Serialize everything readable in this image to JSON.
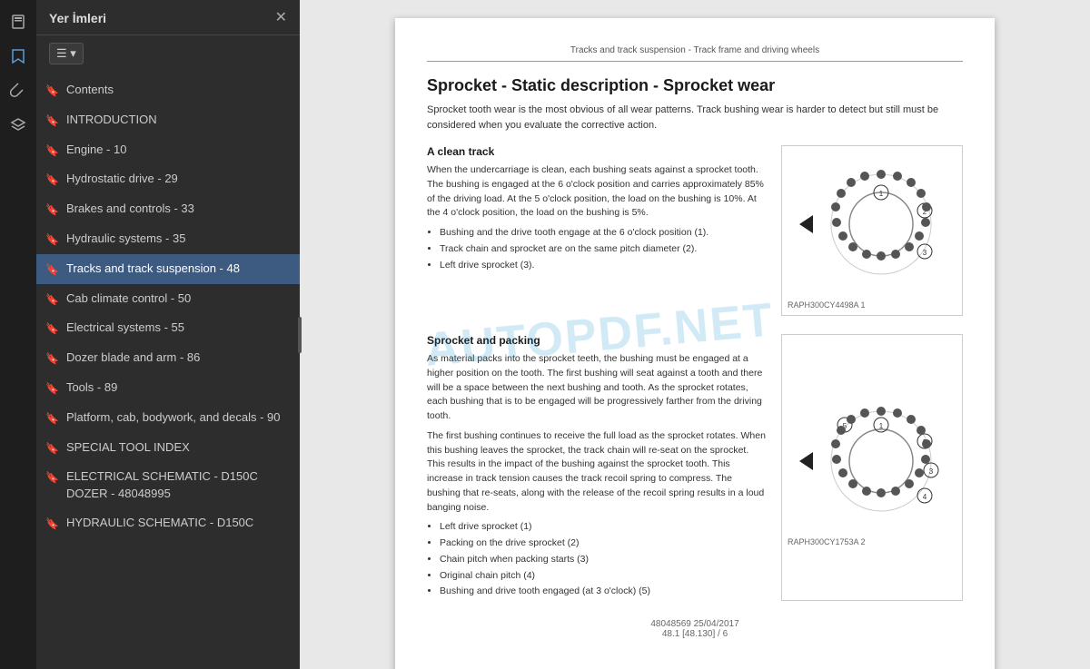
{
  "toolbar": {
    "icons": [
      "📋",
      "🔖",
      "📎",
      "⬡"
    ]
  },
  "sidebar": {
    "title": "Yer İmleri",
    "close_label": "✕",
    "list_button": "☰ ▾",
    "items": [
      {
        "label": "Contents",
        "active": false
      },
      {
        "label": "INTRODUCTION",
        "active": false
      },
      {
        "label": "Engine - 10",
        "active": false
      },
      {
        "label": "Hydrostatic drive - 29",
        "active": false
      },
      {
        "label": "Brakes and controls - 33",
        "active": false
      },
      {
        "label": "Hydraulic systems - 35",
        "active": false
      },
      {
        "label": "Tracks and track suspension - 48",
        "active": true
      },
      {
        "label": "Cab climate control - 50",
        "active": false
      },
      {
        "label": "Electrical systems - 55",
        "active": false
      },
      {
        "label": "Dozer blade and arm - 86",
        "active": false
      },
      {
        "label": "Tools - 89",
        "active": false
      },
      {
        "label": "Platform, cab, bodywork, and decals - 90",
        "active": false
      },
      {
        "label": "SPECIAL TOOL INDEX",
        "active": false
      },
      {
        "label": "ELECTRICAL SCHEMATIC - D150C DOZER - 48048995",
        "active": false
      },
      {
        "label": "HYDRAULIC SCHEMATIC - D150C",
        "active": false
      }
    ]
  },
  "page": {
    "header": "Tracks and track suspension - Track frame and driving wheels",
    "section_title": "Sprocket - Static description - Sprocket wear",
    "intro": "Sprocket tooth wear is the most obvious of all wear patterns. Track bushing wear is harder to detect but still must be considered when you evaluate the corrective action.",
    "subsection1": {
      "title": "A clean track",
      "paragraphs": [
        "When the undercarriage is clean, each bushing seats against a sprocket tooth. The bushing is engaged at the 6 o'clock position and carries approximately 85% of the driving load. At the 5 o'clock position, the load on the bushing is 10%. At the 4 o'clock position, the load on the bushing is 5%."
      ],
      "bullets": [
        "Bushing and the drive tooth engage at the 6 o'clock position (1).",
        "Track chain and sprocket are on the same pitch diameter (2).",
        "Left drive sprocket (3)."
      ],
      "diagram_caption": "RAPH300CY4498A   1"
    },
    "subsection2": {
      "title": "Sprocket and packing",
      "paragraphs": [
        "As material packs into the sprocket teeth, the bushing must be engaged at a higher position on the tooth. The first bushing will seat against a tooth and there will be a space between the next bushing and tooth. As the sprocket rotates, each bushing that is to be engaged will be progressively farther from the driving tooth.",
        "The first bushing continues to receive the full load as the sprocket rotates. When this bushing leaves the sprocket, the track chain will re-seat on the sprocket. This results in the impact of the bushing against the sprocket tooth. This increase in track tension causes the track recoil spring to compress. The bushing that re-seats, along with the release of the recoil spring results in a loud banging noise."
      ],
      "bullets": [
        "Left drive sprocket (1)",
        "Packing on the drive sprocket (2)",
        "Chain pitch when packing starts (3)",
        "Original chain pitch (4)",
        "Bushing and drive tooth engaged (at 3 o'clock) (5)"
      ],
      "diagram_caption": "RAPH300CY1753A   2"
    },
    "footer": {
      "line1": "48048569 25/04/2017",
      "line2": "48.1 [48.130] / 6"
    }
  },
  "watermark": {
    "text": "AUTOPDF.NET"
  }
}
